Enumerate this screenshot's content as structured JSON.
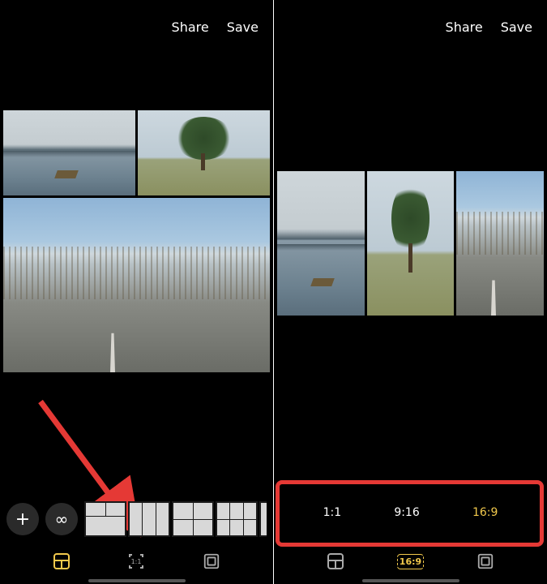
{
  "header": {
    "share": "Share",
    "save": "Save"
  },
  "aspect_options": [
    {
      "label": "1:1",
      "active": false
    },
    {
      "label": "9:16",
      "active": false
    },
    {
      "label": "16:9",
      "active": true
    }
  ],
  "left_tabs": {
    "layout_active": true,
    "aspect_label": "1:1",
    "border_active": false
  },
  "right_tabs": {
    "layout_active": false,
    "aspect_label": "16:9",
    "border_active": false
  },
  "icons": {
    "plus": "+",
    "infinity": "∞"
  }
}
